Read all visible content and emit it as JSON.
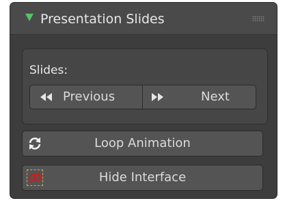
{
  "panel": {
    "title": "Presentation Slides"
  },
  "slides": {
    "label": "Slides:",
    "previous_label": "Previous",
    "next_label": "Next"
  },
  "actions": {
    "loop_label": "Loop Animation",
    "hide_label": "Hide Interface"
  },
  "icons": {
    "collapse": "triangle-down-icon",
    "drag": "grip-icon",
    "prev": "rewind-icon",
    "next": "fast-forward-icon",
    "loop": "loop-icon",
    "hide": "eye-hidden-icon"
  },
  "colors": {
    "accent": "#54c26a",
    "panel_bg": "#3d3d3d",
    "button_bg": "#545454",
    "hide_icon": "#c42020"
  }
}
